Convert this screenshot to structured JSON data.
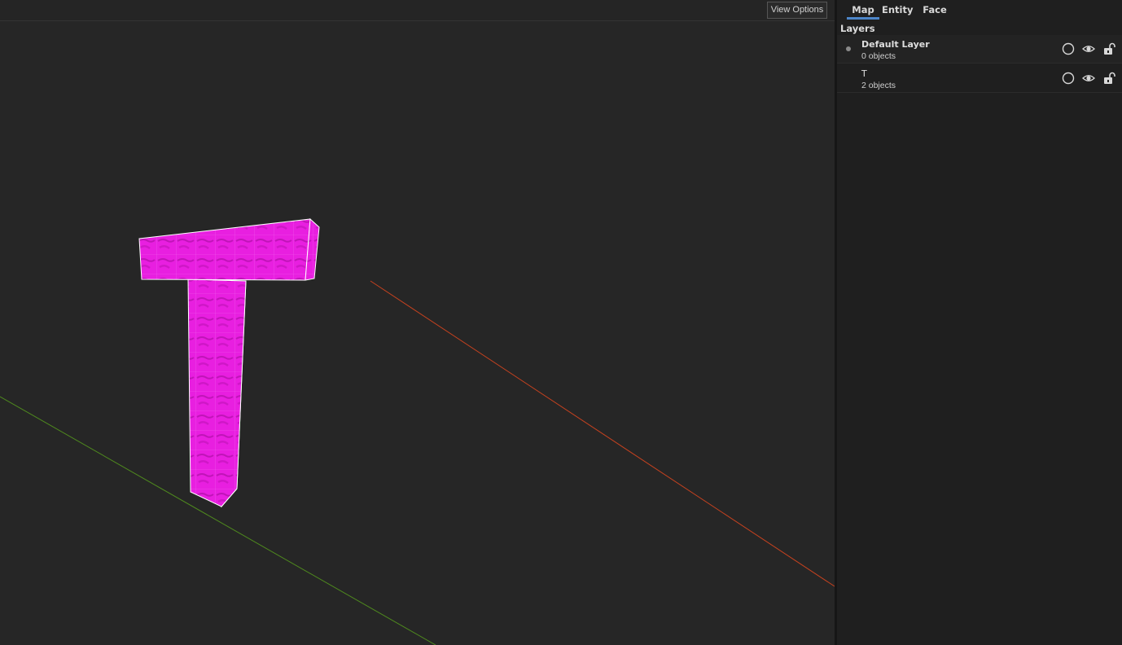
{
  "viewport": {
    "view_options_label": "View Options"
  },
  "inspector": {
    "tabs": [
      {
        "label": "Map",
        "active": true
      },
      {
        "label": "Entity",
        "active": false
      },
      {
        "label": "Face",
        "active": false
      }
    ],
    "layers_heading": "Layers",
    "layers": [
      {
        "name": "Default Layer",
        "count": "0 objects",
        "current": true
      },
      {
        "name": "T",
        "count": "2 objects",
        "current": false
      }
    ]
  },
  "colors": {
    "brush_fill": "#e81fe0",
    "x_axis": "#c6421f",
    "y_axis": "#4f8a1e",
    "tab_indicator": "#4d86c9"
  },
  "icons": [
    "circle-icon",
    "eye-icon",
    "unlock-icon"
  ]
}
